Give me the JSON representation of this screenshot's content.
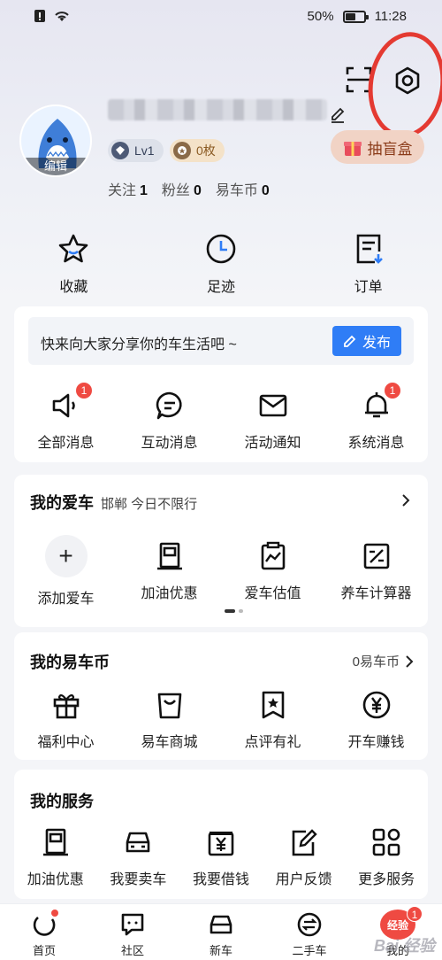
{
  "status": {
    "battery": "50%",
    "time": "11:28"
  },
  "profile": {
    "avatar_edit": "编辑",
    "level": "Lv1",
    "coins": "0枚",
    "blind_box": "抽盲盒",
    "stats": [
      {
        "label": "关注",
        "value": "1"
      },
      {
        "label": "粉丝",
        "value": "0"
      },
      {
        "label": "易车币",
        "value": "0"
      }
    ]
  },
  "quick": [
    {
      "label": "收藏",
      "icon": "star-icon"
    },
    {
      "label": "足迹",
      "icon": "clock-icon"
    },
    {
      "label": "订单",
      "icon": "order-icon"
    }
  ],
  "share": {
    "text": "快来向大家分享你的车生活吧 ~",
    "button": "发布"
  },
  "messages": [
    {
      "label": "全部消息",
      "badge": "1"
    },
    {
      "label": "互动消息",
      "badge": ""
    },
    {
      "label": "活动通知",
      "badge": ""
    },
    {
      "label": "系统消息",
      "badge": "1"
    }
  ],
  "my_car": {
    "title": "我的爱车",
    "subtitle": "邯郸 今日不限行",
    "items": [
      "添加爱车",
      "加油优惠",
      "爱车估值",
      "养车计算器"
    ]
  },
  "my_coin": {
    "title": "我的易车币",
    "right": "0易车币",
    "items": [
      "福利中心",
      "易车商城",
      "点评有礼",
      "开车赚钱"
    ]
  },
  "services": {
    "title": "我的服务",
    "items": [
      "加油优惠",
      "我要卖车",
      "我要借钱",
      "用户反馈",
      "更多服务"
    ]
  },
  "nav": [
    {
      "label": "首页"
    },
    {
      "label": "社区"
    },
    {
      "label": "新车"
    },
    {
      "label": "二手车"
    },
    {
      "label": "我的",
      "bubble": "经验",
      "badge": "1"
    }
  ],
  "watermark": "Bai 经验",
  "colors": {
    "accent": "#2f7df6",
    "badge": "#ef4a42",
    "highlight_ring": "#e43a32"
  }
}
